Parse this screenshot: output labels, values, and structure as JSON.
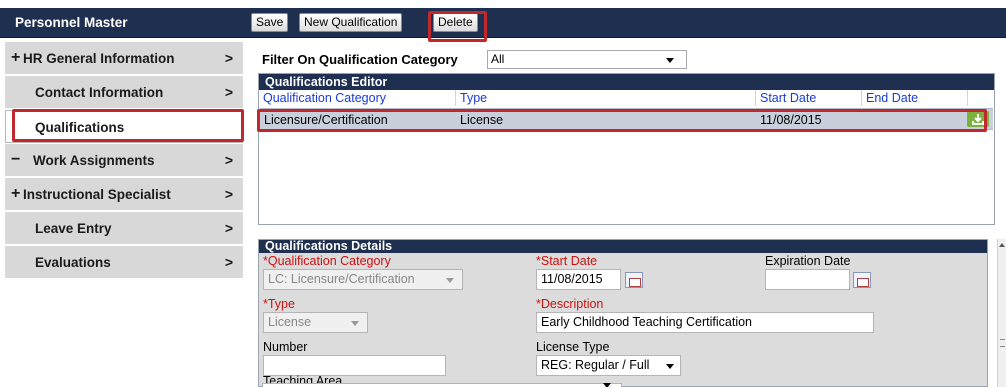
{
  "header": {
    "title": "Personnel Master",
    "buttons": {
      "save": "Save",
      "new_qualification": "New Qualification",
      "delete": "Delete"
    }
  },
  "sidebar": {
    "items": [
      {
        "symbol": "+",
        "label": "HR General Information",
        "arrow": ">"
      },
      {
        "symbol": "",
        "label": "Contact Information",
        "arrow": ">"
      },
      {
        "symbol": "",
        "label": "Qualifications",
        "arrow": ""
      },
      {
        "symbol": "−",
        "label": "Work Assignments",
        "arrow": ">"
      },
      {
        "symbol": "+",
        "label": "Instructional Specialist",
        "arrow": ">"
      },
      {
        "symbol": "",
        "label": "Leave Entry",
        "arrow": ">"
      },
      {
        "symbol": "",
        "label": "Evaluations",
        "arrow": ">"
      }
    ]
  },
  "filter": {
    "label": "Filter On Qualification Category",
    "value": "All"
  },
  "editor": {
    "title": "Qualifications Editor",
    "columns": [
      "Qualification Category",
      "Type",
      "Start Date",
      "End Date"
    ],
    "rows": [
      {
        "category": "Licensure/Certification",
        "type": "License",
        "start_date": "11/08/2015",
        "end_date": ""
      }
    ],
    "row_icon": "download-icon"
  },
  "details": {
    "title": "Qualifications Details",
    "qualification_category": {
      "label": "*Qualification Category",
      "value": "LC: Licensure/Certification"
    },
    "start_date": {
      "label": "*Start Date",
      "value": "11/08/2015"
    },
    "expiration_date": {
      "label": "Expiration Date",
      "value": ""
    },
    "type": {
      "label": "*Type",
      "value": "License"
    },
    "description": {
      "label": "*Description",
      "value": "Early Childhood Teaching Certification"
    },
    "number": {
      "label": "Number",
      "value": ""
    },
    "license_type": {
      "label": "License Type",
      "value": "REG: Regular / Full"
    },
    "teaching_area": {
      "label": "Teaching Area",
      "value": ""
    }
  },
  "colors": {
    "header_bg": "#1f2f4f",
    "highlight": "#c0282d",
    "sidebar_bg": "#d8d8d8",
    "link_blue": "#1a3bd6"
  }
}
